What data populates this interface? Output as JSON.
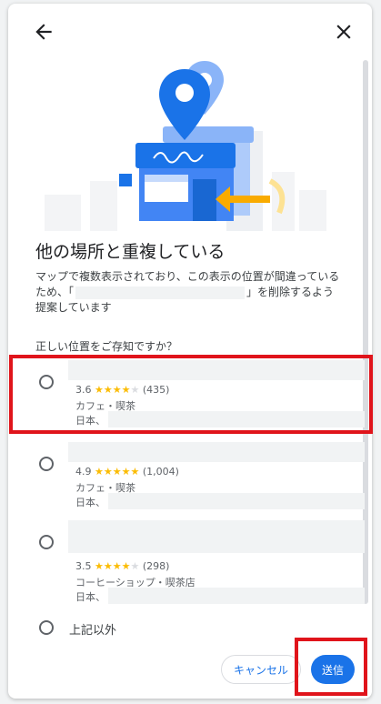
{
  "header": {
    "back_icon": "arrow-left-icon",
    "close_icon": "close-icon"
  },
  "content": {
    "title": "他の場所と重複している",
    "desc_part1": "マップで複数表示されており、この表示の位置が間違っているため、「",
    "desc_part2": "」を削除するよう提案しています",
    "question": "正しい位置をご存知ですか？"
  },
  "options": [
    {
      "rating": "3.6",
      "stars": "★★★★",
      "stars_empty": "★",
      "count": "(435)",
      "category": "カフェ・喫茶",
      "address": "日本、"
    },
    {
      "rating": "4.9",
      "stars": "★★★★★",
      "stars_empty": "",
      "count": "(1,004)",
      "category": "カフェ・喫茶",
      "address": "日本、"
    },
    {
      "rating": "3.5",
      "stars": "★★★★",
      "stars_empty": "★",
      "count": "(298)",
      "category": "コーヒーショップ・喫茶店",
      "address": "日本、"
    }
  ],
  "other_option": "上記以外",
  "actions": {
    "cancel": "キャンセル",
    "submit": "送信"
  },
  "colors": {
    "accent": "#1a73e8",
    "highlight": "#e0141b",
    "star": "#fbbc04"
  }
}
